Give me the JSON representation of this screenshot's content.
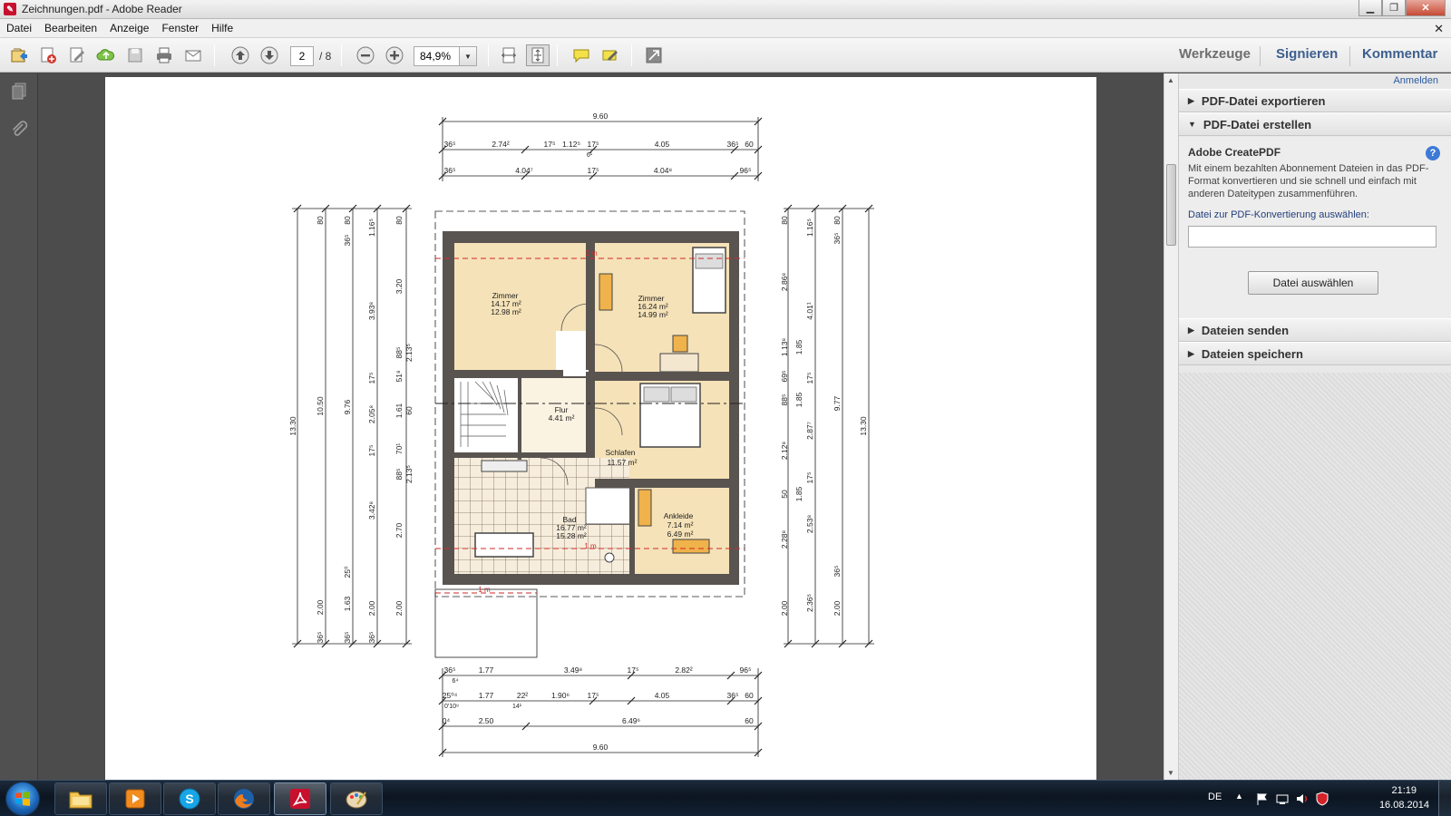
{
  "window": {
    "title": "Zeichnungen.pdf - Adobe Reader"
  },
  "menu": {
    "items": [
      "Datei",
      "Bearbeiten",
      "Anzeige",
      "Fenster",
      "Hilfe"
    ]
  },
  "toolbar": {
    "page_current": "2",
    "page_total": "/ 8",
    "zoom": "84,9%",
    "tabs": {
      "werkzeuge": "Werkzeuge",
      "signieren": "Signieren",
      "kommentar": "Kommentar"
    }
  },
  "right_pane": {
    "sign_in": "Anmelden",
    "panels": [
      {
        "label": "PDF-Datei exportieren",
        "expanded": false
      },
      {
        "label": "PDF-Datei erstellen",
        "expanded": true
      },
      {
        "label": "Dateien senden",
        "expanded": false
      },
      {
        "label": "Dateien speichern",
        "expanded": false
      }
    ],
    "create_pdf": {
      "title": "Adobe CreatePDF",
      "description": "Mit einem bezahlten Abonnement Dateien in das PDF-Format konvertieren und sie schnell und einfach mit anderen Dateitypen zusammenführen.",
      "file_label": "Datei zur PDF-Konvertierung auswählen:",
      "file_value": "",
      "button": "Datei auswählen"
    }
  },
  "plan": {
    "rooms": [
      {
        "name": "Zimmer",
        "a1": "14.17 m²",
        "a2": "12.98 m²"
      },
      {
        "name": "Zimmer",
        "a1": "16.24 m²",
        "a2": "14.99 m²"
      },
      {
        "name": "Flur",
        "a1": "4.41 m²"
      },
      {
        "name": "Schlafen",
        "a1": "11.57 m²"
      },
      {
        "name": "Bad",
        "a1": "16.77 m²",
        "a2": "15.28 m²"
      },
      {
        "name": "Ankleide",
        "a1": "7.14 m²",
        "a2": "6.49 m²"
      }
    ],
    "markers": {
      "top": "2 m",
      "bad": "1 m",
      "bottom": "1 m"
    },
    "dims_top": {
      "overall": "9.60",
      "row1": [
        "36⁵",
        "2.74²",
        "17⁵",
        "1.12⁵",
        "17⁵",
        "4.05",
        "36⁵",
        "60"
      ],
      "row1_small": "6¹",
      "row2": [
        "36⁵",
        "4.04⁷",
        "17⁵",
        "4.04⁸",
        "96⁵"
      ]
    },
    "dims_bottom": {
      "row1": [
        "36⁵",
        "1.77",
        "3.49⁸",
        "17⁵",
        "2.82²",
        "96⁵"
      ],
      "row1_small": "6⁴",
      "row2": [
        "25⁰⁴",
        "1.77",
        "22²",
        "1.90⁶",
        "17⁵",
        "4.05",
        "36⁵",
        "60"
      ],
      "row2_small": [
        "0'10⁹",
        "14¹"
      ],
      "row3": [
        "0⁴",
        "2.50",
        "6.49⁶",
        "60"
      ],
      "overall": "9.60"
    },
    "dims_left": {
      "overall": "13.30",
      "col2": [
        "80",
        "10.50",
        "2.00",
        "36⁵"
      ],
      "col3": [
        "80",
        "36⁵",
        "9.76",
        "1.63",
        "36⁵",
        "3.93⁸",
        "17⁵",
        "2.05⁸",
        "17⁵",
        "3.42⁸",
        "25⁰"
      ],
      "col4": [
        "1.16⁵",
        "88⁵",
        "51⁸",
        "1.61",
        "70¹",
        "88⁵",
        "2.00",
        "36⁵"
      ],
      "col5": [
        "80",
        "3.20",
        "2.13⁵",
        "60",
        "2.13⁵",
        "2.70",
        "2.00"
      ]
    },
    "dims_right": {
      "overall": "13.30",
      "col1": [
        "80",
        "2.86⁸",
        "1.13⁸",
        "69⁵",
        "88⁵",
        "2.12⁸",
        "50",
        "2.28⁸",
        "2.00"
      ],
      "col2": [
        "1.16⁵",
        "4.01¹",
        "1.85",
        "1.85",
        "2.87⁷",
        "1.85",
        "2.53⁸",
        "2.36⁵"
      ],
      "col3": [
        "17⁵",
        "17⁵",
        "36⁵"
      ],
      "col4": [
        "80",
        "36⁵",
        "9.77",
        "2.00"
      ]
    }
  },
  "taskbar": {
    "language": "DE",
    "time": "21:19",
    "date": "16.08.2014",
    "apps": [
      "file-explorer",
      "media-player",
      "skype",
      "firefox",
      "adobe-reader",
      "paint"
    ]
  }
}
